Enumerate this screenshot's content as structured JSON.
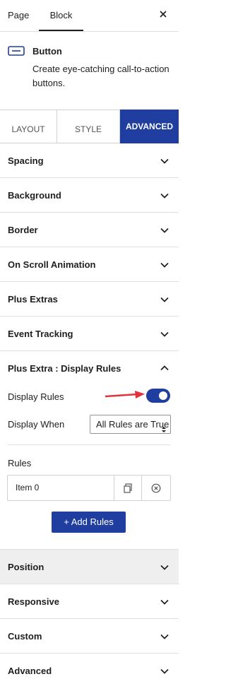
{
  "sidebar_tabs": {
    "page": "Page",
    "block": "Block"
  },
  "block": {
    "name": "Button",
    "description": "Create eye-catching call-to-action buttons."
  },
  "settings_tabs": {
    "layout": "Layout",
    "style": "Style",
    "advanced": "Advanced"
  },
  "panels": {
    "spacing": "Spacing",
    "background": "Background",
    "border": "Border",
    "on_scroll_animation": "On Scroll Animation",
    "plus_extras": "Plus Extras",
    "event_tracking": "Event Tracking",
    "display_rules": "Plus Extra : Display Rules",
    "position": "Position",
    "responsive": "Responsive",
    "custom": "Custom",
    "advanced": "Advanced"
  },
  "display_rules": {
    "toggle_label": "Display Rules",
    "toggle_on": true,
    "when_label": "Display When",
    "when_value": "All Rules are True",
    "rules_label": "Rules",
    "item_label": "Item 0",
    "add_button": "+ Add Rules"
  },
  "colors": {
    "accent": "#1f3ea0",
    "annotation_arrow": "#e0343a"
  }
}
